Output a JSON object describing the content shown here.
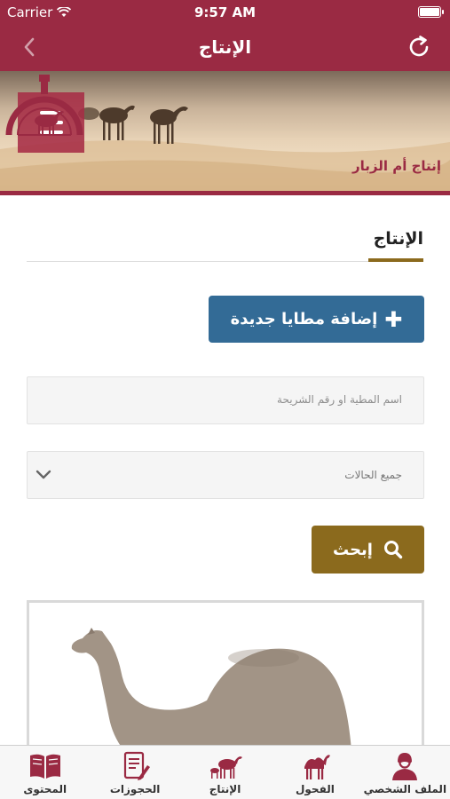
{
  "status_bar": {
    "carrier": "Carrier",
    "time": "9:57 AM"
  },
  "nav": {
    "title": "الإنتاج",
    "back_icon": "chevron-left-icon",
    "refresh_icon": "refresh-icon"
  },
  "banner": {
    "logo_text": "إنتاج أم الزبار",
    "menu_icon": "hamburger-menu-icon"
  },
  "section": {
    "title": "الإنتاج"
  },
  "actions": {
    "add_label": "إضافة مطايا جديدة"
  },
  "search": {
    "placeholder": "اسم المطية او رقم الشريحة"
  },
  "status_filter": {
    "selected": "جميع الحالات"
  },
  "search_button": {
    "label": "إبحث"
  },
  "tabs": [
    {
      "label": "المحتوى",
      "icon": "book-icon"
    },
    {
      "label": "الحجوزات",
      "icon": "document-pen-icon"
    },
    {
      "label": "الإنتاج",
      "icon": "camel-mother-calf-icon"
    },
    {
      "label": "الفحول",
      "icon": "camel-icon"
    },
    {
      "label": "الملف الشخصي",
      "icon": "user-profile-icon"
    }
  ],
  "colors": {
    "brand": "#9a2a43",
    "primary_button": "#336b96",
    "search_button": "#8b6a1d"
  }
}
